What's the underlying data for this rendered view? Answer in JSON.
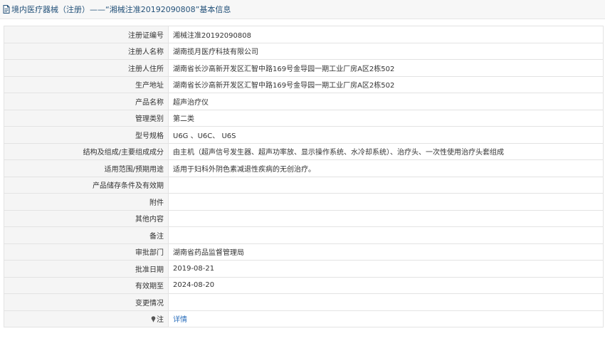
{
  "header": {
    "title": "境内医疗器械（注册）——“湘械注准20192090808”基本信息",
    "icon": "document-icon"
  },
  "rows": [
    {
      "label": "注册证编号",
      "value": "湘械注准20192090808"
    },
    {
      "label": "注册人名称",
      "value": "湖南揽月医疗科技有限公司"
    },
    {
      "label": "注册人住所",
      "value": "湖南省长沙高新开发区汇智中路169号金导园一期工业厂房A区2栋502"
    },
    {
      "label": "生产地址",
      "value": "湖南省长沙高新开发区汇智中路169号金导园一期工业厂房A区2栋502"
    },
    {
      "label": "产品名称",
      "value": "超声治疗仪"
    },
    {
      "label": "管理类别",
      "value": "第二类"
    },
    {
      "label": "型号规格",
      "value": "U6G 、U6C、 U6S"
    },
    {
      "label": "结构及组成/主要组成成分",
      "value": "由主机（超声信号发生器、超声功率放、显示操作系统、水冷却系统）、治疗头、一次性使用治疗头套组成"
    },
    {
      "label": "适用范围/预期用途",
      "value": "适用于妇科外阴色素减退性疾病的无创治疗。"
    },
    {
      "label": "产品储存条件及有效期",
      "value": ""
    },
    {
      "label": "附件",
      "value": ""
    },
    {
      "label": "其他内容",
      "value": ""
    },
    {
      "label": "备注",
      "value": ""
    },
    {
      "label": "审批部门",
      "value": "湖南省药品监督管理局"
    },
    {
      "label": "批准日期",
      "value": "2019-08-21"
    },
    {
      "label": "有效期至",
      "value": "2024-08-20"
    },
    {
      "label": "变更情况",
      "value": ""
    }
  ],
  "note_row": {
    "label": "注",
    "icon": "pin-icon",
    "link_text": "详情"
  },
  "colors": {
    "header_text": "#24527a",
    "link": "#2a6ebb",
    "label_bg": "#f5f5f5",
    "border": "#e3e3e3"
  }
}
